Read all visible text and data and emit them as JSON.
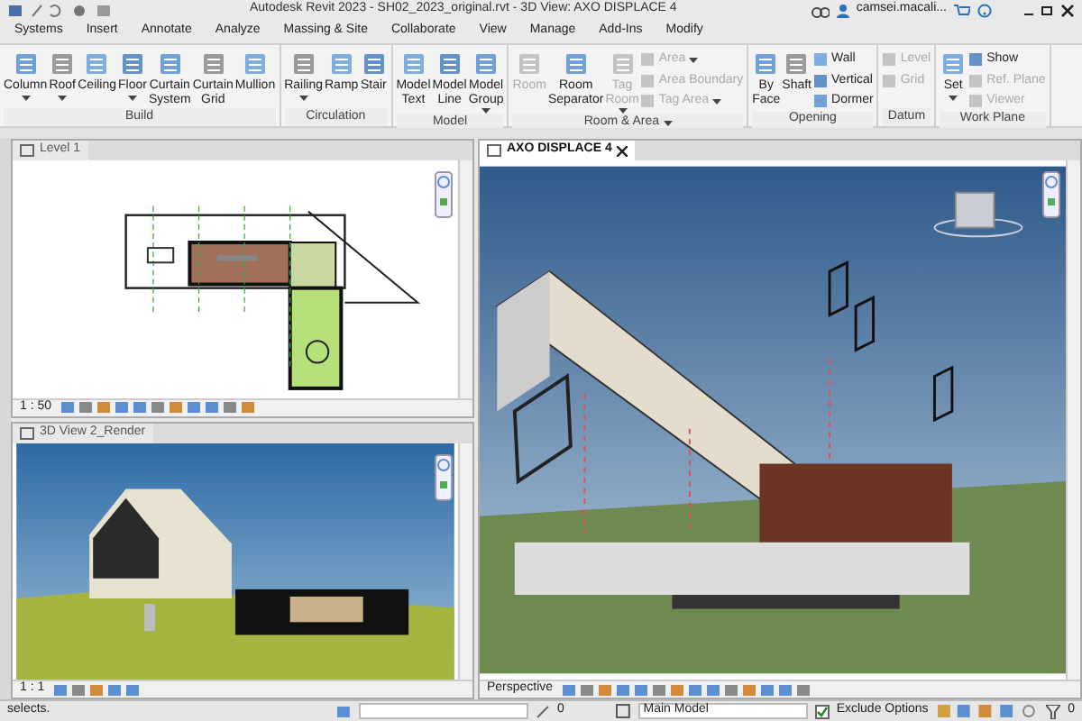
{
  "title_bar": {
    "title": "Autodesk Revit 2023 - SH02_2023_original.rvt - 3D View: AXO DISPLACE 4",
    "user": "camsei.macali..."
  },
  "menu_tabs": [
    "Systems",
    "Insert",
    "Annotate",
    "Analyze",
    "Massing & Site",
    "Collaborate",
    "View",
    "Manage",
    "Add-Ins",
    "Modify"
  ],
  "ribbon": {
    "panels": [
      {
        "title": "Build",
        "dropdown": false,
        "items": [
          {
            "kind": "large",
            "label": "Column",
            "dropdown": true,
            "disabled": false
          },
          {
            "kind": "large",
            "label": "Roof",
            "dropdown": true,
            "disabled": false
          },
          {
            "kind": "large",
            "label": "Ceiling",
            "dropdown": false,
            "disabled": false
          },
          {
            "kind": "large",
            "label": "Floor",
            "dropdown": true,
            "disabled": false
          },
          {
            "kind": "large",
            "label": "Curtain System",
            "dropdown": false,
            "disabled": false
          },
          {
            "kind": "large",
            "label": "Curtain Grid",
            "dropdown": false,
            "disabled": false
          },
          {
            "kind": "large",
            "label": "Mullion",
            "dropdown": false,
            "disabled": false
          }
        ]
      },
      {
        "title": "Circulation",
        "dropdown": false,
        "items": [
          {
            "kind": "large",
            "label": "Railing",
            "dropdown": true,
            "disabled": false
          },
          {
            "kind": "large",
            "label": "Ramp",
            "dropdown": false,
            "disabled": false
          },
          {
            "kind": "large",
            "label": "Stair",
            "dropdown": false,
            "disabled": false
          }
        ]
      },
      {
        "title": "Model",
        "dropdown": false,
        "items": [
          {
            "kind": "large",
            "label": "Model Text",
            "dropdown": false,
            "disabled": false
          },
          {
            "kind": "large",
            "label": "Model Line",
            "dropdown": false,
            "disabled": false
          },
          {
            "kind": "large",
            "label": "Model Group",
            "dropdown": true,
            "disabled": false
          }
        ]
      },
      {
        "title": "Room & Area",
        "dropdown": true,
        "items": [
          {
            "kind": "large",
            "label": "Room",
            "dropdown": false,
            "disabled": true
          },
          {
            "kind": "large",
            "label": "Room Separator",
            "dropdown": false,
            "disabled": false
          },
          {
            "kind": "large",
            "label": "Tag Room",
            "dropdown": true,
            "disabled": true
          },
          {
            "kind": "small",
            "label": "Area",
            "dropdown": true,
            "disabled": true
          },
          {
            "kind": "small",
            "label": "Area Boundary",
            "dropdown": false,
            "disabled": true
          },
          {
            "kind": "small",
            "label": "Tag Area",
            "dropdown": true,
            "disabled": true
          }
        ]
      },
      {
        "title": "Opening",
        "dropdown": false,
        "items": [
          {
            "kind": "large",
            "label": "By Face",
            "dropdown": false,
            "disabled": false
          },
          {
            "kind": "large",
            "label": "Shaft",
            "dropdown": false,
            "disabled": false
          },
          {
            "kind": "small",
            "label": "Wall",
            "dropdown": false,
            "disabled": false
          },
          {
            "kind": "small",
            "label": "Vertical",
            "dropdown": false,
            "disabled": false
          },
          {
            "kind": "small",
            "label": "Dormer",
            "dropdown": false,
            "disabled": false
          }
        ]
      },
      {
        "title": "Datum",
        "dropdown": false,
        "items": [
          {
            "kind": "small",
            "label": "Level",
            "dropdown": false,
            "disabled": true
          },
          {
            "kind": "small",
            "label": "Grid",
            "dropdown": false,
            "disabled": true
          }
        ]
      },
      {
        "title": "Work Plane",
        "dropdown": false,
        "items": [
          {
            "kind": "large",
            "label": "Set",
            "dropdown": true,
            "disabled": false
          },
          {
            "kind": "small",
            "label": "Show",
            "dropdown": false,
            "disabled": false
          },
          {
            "kind": "small",
            "label": "Ref. Plane",
            "dropdown": false,
            "disabled": true
          },
          {
            "kind": "small",
            "label": "Viewer",
            "dropdown": false,
            "disabled": true
          }
        ]
      }
    ]
  },
  "views": [
    {
      "kind": "plan",
      "title": "Level 1",
      "scale": "1 : 50",
      "active": false
    },
    {
      "kind": "render",
      "title": "3D View 2_Render",
      "scale": "1 : 1",
      "active": false
    },
    {
      "kind": "axo",
      "title": "AXO DISPLACE 4",
      "scale": "Perspective",
      "active": true
    }
  ],
  "status_bar": {
    "message": "selects.",
    "edit_count": "0",
    "workset": "Main Model",
    "exclude_options": {
      "label": "Exclude Options",
      "checked": true
    },
    "filter_count": "0"
  }
}
